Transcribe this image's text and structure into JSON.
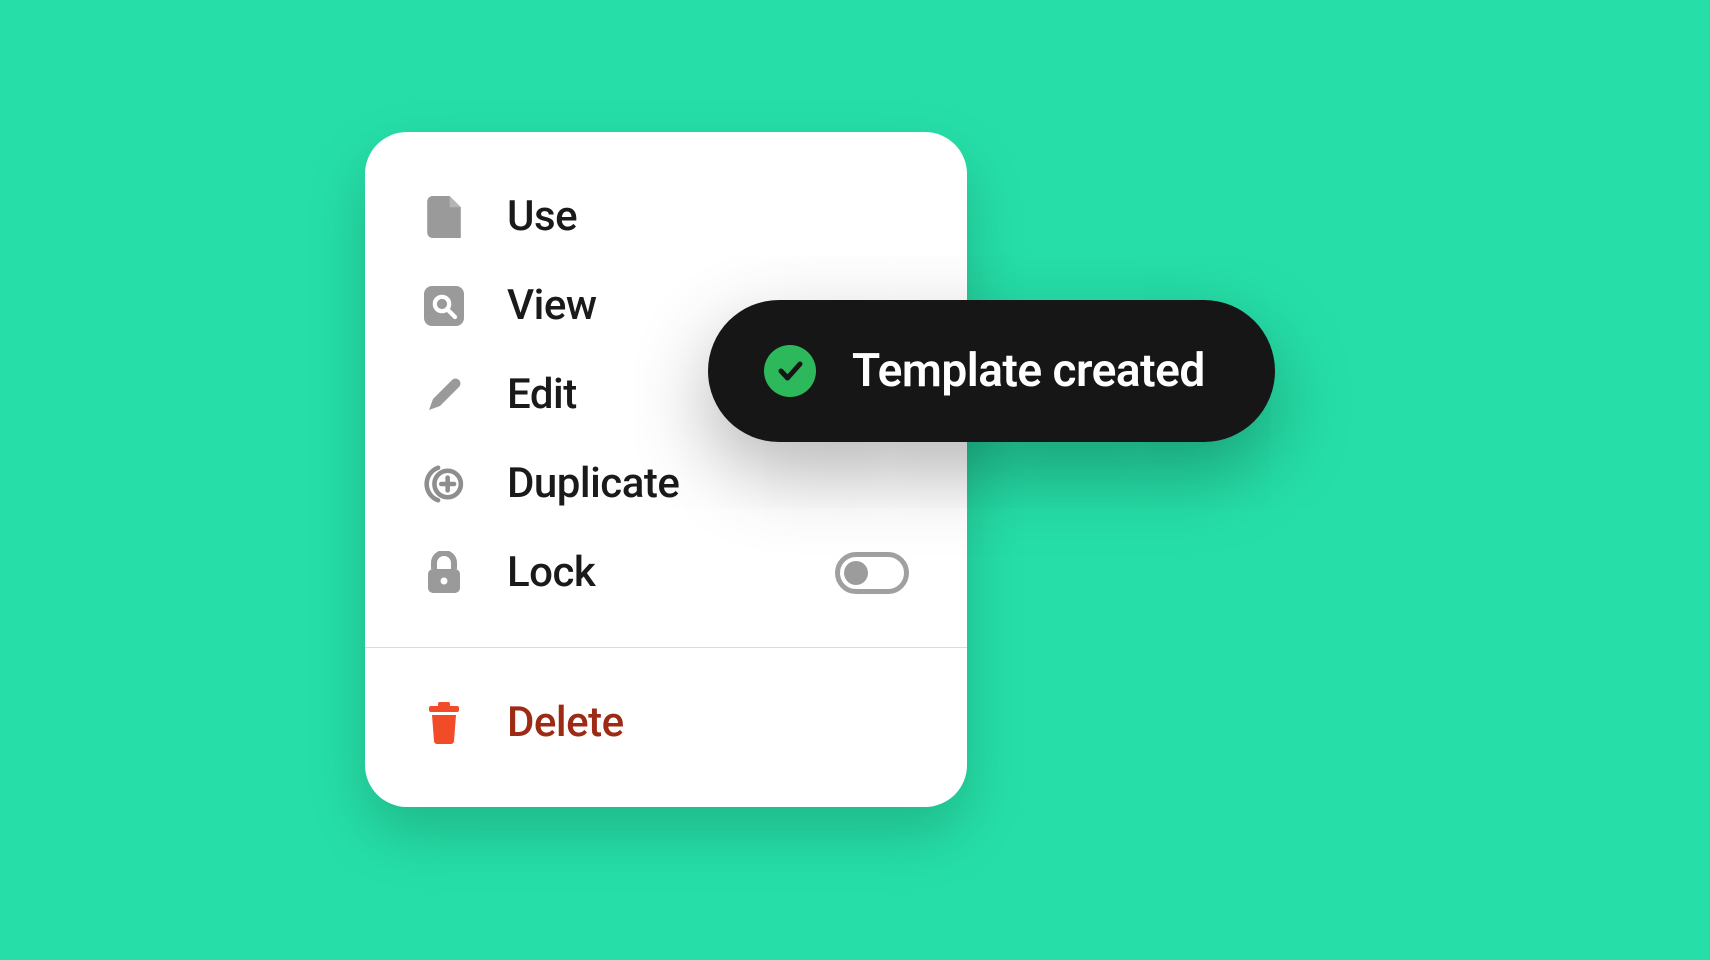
{
  "menu": {
    "items": [
      {
        "label": "Use"
      },
      {
        "label": "View"
      },
      {
        "label": "Edit"
      },
      {
        "label": "Duplicate"
      },
      {
        "label": "Lock"
      }
    ],
    "lockToggle": {
      "on": false
    },
    "delete": {
      "label": "Delete"
    }
  },
  "toast": {
    "message": "Template created"
  },
  "colors": {
    "background": "#26dfa8",
    "menuBg": "#ffffff",
    "iconGray": "#9a9a9a",
    "text": "#1a1a1a",
    "danger": "#9c2a14",
    "deleteIcon": "#f14b28",
    "toastBg": "#161616",
    "toastCheckBg": "#2db85c"
  }
}
